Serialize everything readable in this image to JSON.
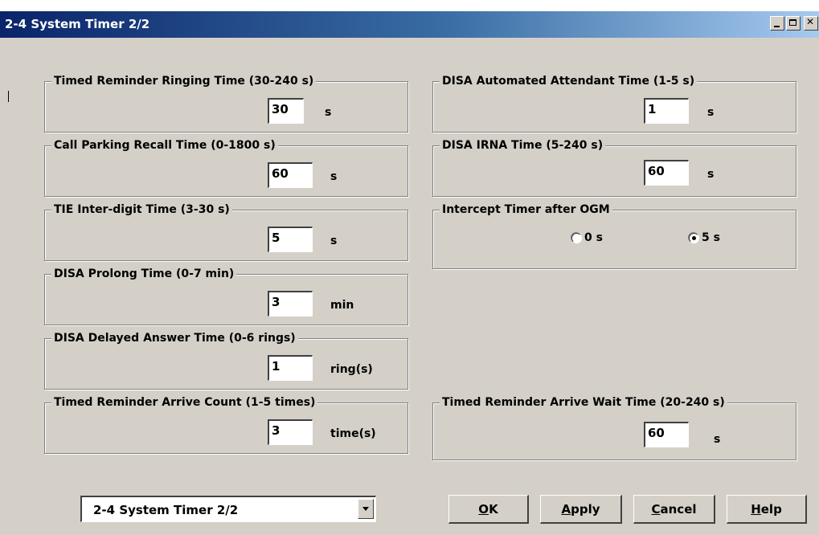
{
  "window": {
    "title": "2-4 System Timer 2/2"
  },
  "left_groups": [
    {
      "label": "Timed Reminder Ringing Time (30-240 s)",
      "value": "30",
      "unit": "s"
    },
    {
      "label": "Call Parking Recall Time (0-1800 s)",
      "value": "60",
      "unit": "s"
    },
    {
      "label": "TIE Inter-digit Time (3-30 s)",
      "value": "5",
      "unit": "s"
    },
    {
      "label": "DISA Prolong Time (0-7 min)",
      "value": "3",
      "unit": "min"
    },
    {
      "label": "DISA Delayed Answer Time (0-6 rings)",
      "value": "1",
      "unit": "ring(s)"
    },
    {
      "label": "Timed Reminder Arrive Count (1-5 times)",
      "value": "3",
      "unit": "time(s)"
    }
  ],
  "right_groups": {
    "disa_attendant": {
      "label": "DISA Automated Attendant Time (1-5 s)",
      "value": "1",
      "unit": "s"
    },
    "disa_irna": {
      "label": "DISA IRNA Time (5-240 s)",
      "value": "60",
      "unit": "s"
    },
    "intercept": {
      "label": "Intercept Timer after OGM",
      "options": [
        {
          "label": "0 s",
          "selected": false
        },
        {
          "label": "5 s",
          "selected": true
        }
      ]
    },
    "arrive_wait": {
      "label": "Timed Reminder Arrive Wait Time (20-240 s)",
      "value": "60",
      "unit": "s"
    }
  },
  "footer": {
    "page_select": "2-4 System Timer 2/2",
    "ok": {
      "mnemonic": "O",
      "rest": "K"
    },
    "apply": {
      "mnemonic": "A",
      "rest": "pply"
    },
    "cancel": {
      "mnemonic": "C",
      "rest": "ancel"
    },
    "help": {
      "mnemonic": "H",
      "rest": "elp"
    }
  }
}
